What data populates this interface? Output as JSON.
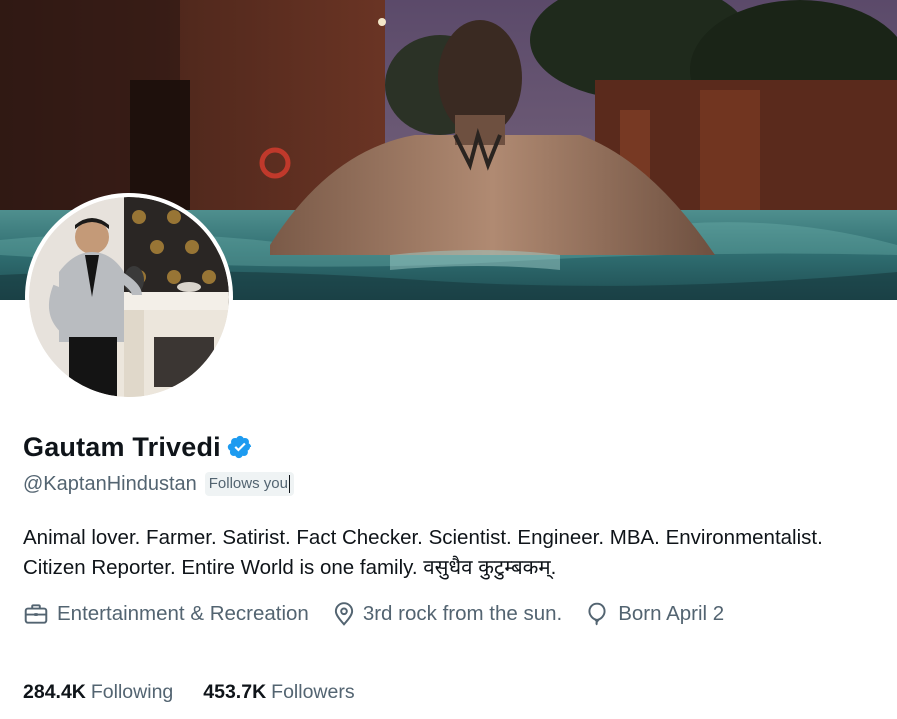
{
  "profile": {
    "display_name": "Gautam Trivedi",
    "handle": "@KaptanHindustan",
    "follows_you_label": "Follows you",
    "bio_line1": "Animal lover. Farmer. Satirist. Fact Checker. Scientist. Engineer. MBA. Environmentalist.",
    "bio_line2": "Citizen Reporter. Entire World is one family. वसुधैव कुटुम्बकम्.",
    "verified": true
  },
  "meta": {
    "category": "Entertainment & Recreation",
    "location": "3rd rock from the sun.",
    "birthday": "Born April 2"
  },
  "stats": {
    "following_count": "284.4K",
    "following_label": "Following",
    "followers_count": "453.7K",
    "followers_label": "Followers"
  },
  "icons": {
    "verified": "verified-badge-icon",
    "category": "briefcase-icon",
    "location": "location-pin-icon",
    "birthday": "balloon-icon"
  },
  "colors": {
    "verified_blue": "#1d9bf0",
    "secondary_text": "#536471",
    "primary_text": "#0f1419"
  }
}
